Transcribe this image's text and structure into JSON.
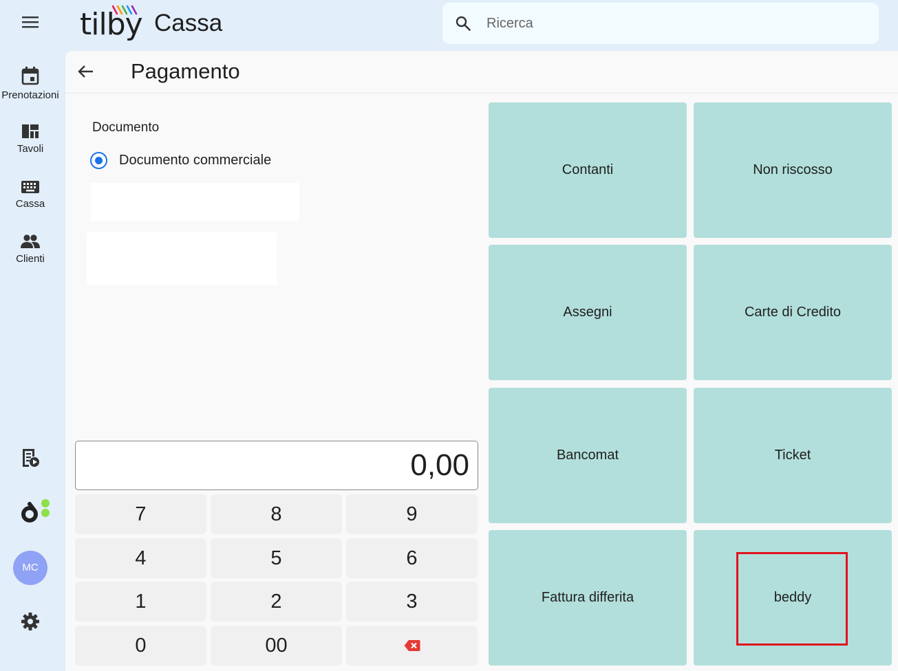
{
  "header": {
    "logo_text": "tilby",
    "app_title": "Cassa",
    "search_placeholder": "Ricerca"
  },
  "sidebar": {
    "items": [
      {
        "label": "Prenotazioni",
        "icon": "calendar-icon"
      },
      {
        "label": "Tavoli",
        "icon": "tables-layout-icon"
      },
      {
        "label": "Cassa",
        "icon": "keyboard-icon"
      },
      {
        "label": "Clienti",
        "icon": "people-icon"
      }
    ],
    "bottom_icons": [
      "receipt-play-icon",
      "brand-logo-icon",
      "settings-gear-icon"
    ],
    "avatar_initials": "MC"
  },
  "page": {
    "title": "Pagamento",
    "document_label": "Documento",
    "document_option": "Documento commerciale"
  },
  "amount": "0,00",
  "keypad": {
    "keys": [
      "7",
      "8",
      "9",
      "4",
      "5",
      "6",
      "1",
      "2",
      "3",
      "0",
      "00"
    ],
    "backspace_icon": "backspace-icon"
  },
  "payment_methods": [
    "Contanti",
    "Non riscosso",
    "Assegni",
    "Carte di Credito",
    "Bancomat",
    "Ticket",
    "Fattura differita",
    "beddy"
  ],
  "colors": {
    "background": "#e2eef9",
    "payment_button": "#b2dfdb",
    "radio_accent": "#1a73e8",
    "highlight": "#e0141e",
    "avatar": "#8fa2f5",
    "backspace": "#e53935"
  }
}
